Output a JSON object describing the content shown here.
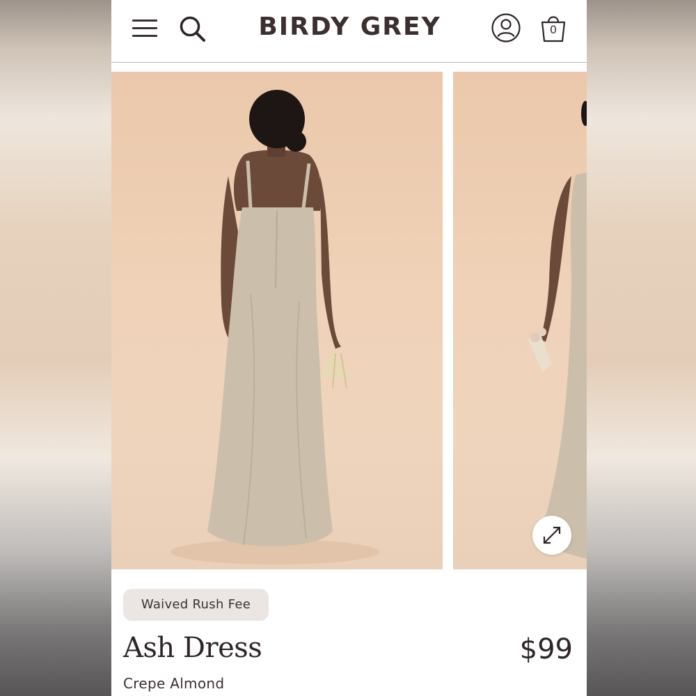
{
  "header": {
    "brand": "BIRDY GREY",
    "bag_count": "0",
    "icons": {
      "menu": "hamburger-menu-icon",
      "search": "search-icon",
      "account": "account-icon",
      "bag": "shopping-bag-icon"
    }
  },
  "gallery": {
    "images": [
      {
        "semantic": "model-back-view-photo"
      },
      {
        "semantic": "model-side-view-photo"
      }
    ],
    "expand_icon": "expand-arrows-icon"
  },
  "product": {
    "badge": "Waived Rush Fee",
    "name": "Ash Dress",
    "price": "$99",
    "color": "Crepe Almond"
  },
  "colors": {
    "text": "#2e2626",
    "badge_bg": "#ebe6e3",
    "photo_bg": "#efd2b8",
    "dress": "#c9bba7"
  }
}
